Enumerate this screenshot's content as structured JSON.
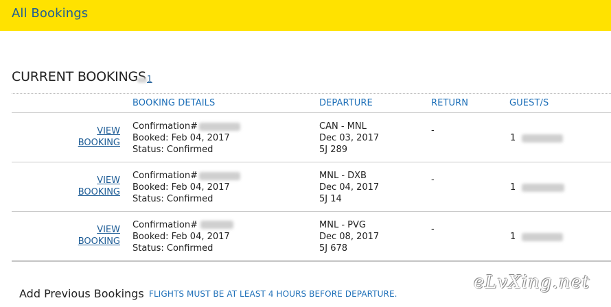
{
  "header": {
    "title": "All Bookings"
  },
  "current_bookings": {
    "title": "CURRENT BOOKINGS",
    "count": "1",
    "columns": {
      "booking_details": "BOOKING DETAILS",
      "departure": "DEPARTURE",
      "return": "RETURN",
      "guests": "GUEST/S"
    },
    "rows": [
      {
        "view_line1": "VIEW",
        "view_line2": "BOOKING",
        "confirmation_label": "Confirmation#",
        "booked": "Booked: Feb 04, 2017",
        "status": "Status: Confirmed",
        "route": "CAN - MNL",
        "date": "Dec 03, 2017",
        "flight": "5J 289",
        "return": "-",
        "guests": "1"
      },
      {
        "view_line1": "VIEW",
        "view_line2": "BOOKING",
        "confirmation_label": "Confirmation#",
        "booked": "Booked: Feb 04, 2017",
        "status": "Status: Confirmed",
        "route": "MNL - DXB",
        "date": "Dec 04, 2017",
        "flight": "5J 14",
        "return": "-",
        "guests": "1"
      },
      {
        "view_line1": "VIEW",
        "view_line2": "BOOKING",
        "confirmation_label": "Confirmation#",
        "booked": "Booked: Feb 04, 2017",
        "status": "Status: Confirmed",
        "route": "MNL - PVG",
        "date": "Dec 08, 2017",
        "flight": "5J 678",
        "return": "-",
        "guests": "1"
      }
    ]
  },
  "add_previous": {
    "title": "Add Previous Bookings",
    "note": "FLIGHTS MUST BE AT LEAST 4 HOURS BEFORE DEPARTURE."
  },
  "watermark": "eLvXing.net",
  "colors": {
    "header_bg": "#ffe200",
    "link": "#1d5c96",
    "column_header": "#1d6fb8"
  }
}
